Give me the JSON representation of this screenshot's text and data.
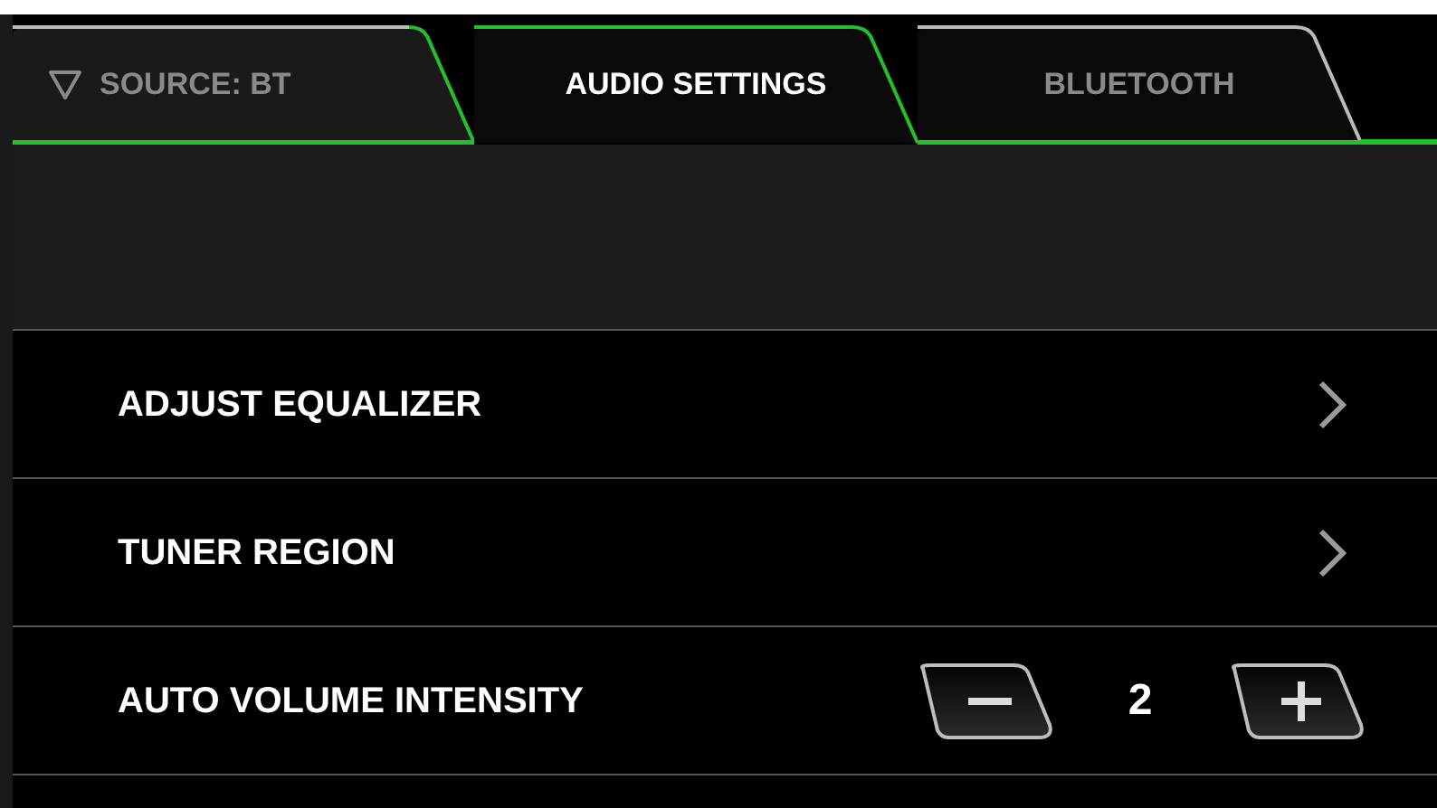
{
  "tabs": [
    {
      "label": "SOURCE: BT",
      "kind": "source",
      "selected": false
    },
    {
      "label": "AUDIO SETTINGS",
      "kind": "tab",
      "selected": true
    },
    {
      "label": "BLUETOOTH",
      "kind": "tab",
      "selected": false
    }
  ],
  "rows": [
    {
      "label": "ADJUST EQUALIZER",
      "kind": "link"
    },
    {
      "label": "TUNER REGION",
      "kind": "link"
    },
    {
      "label": "AUTO VOLUME INTENSITY",
      "kind": "stepper",
      "value": "2"
    }
  ]
}
